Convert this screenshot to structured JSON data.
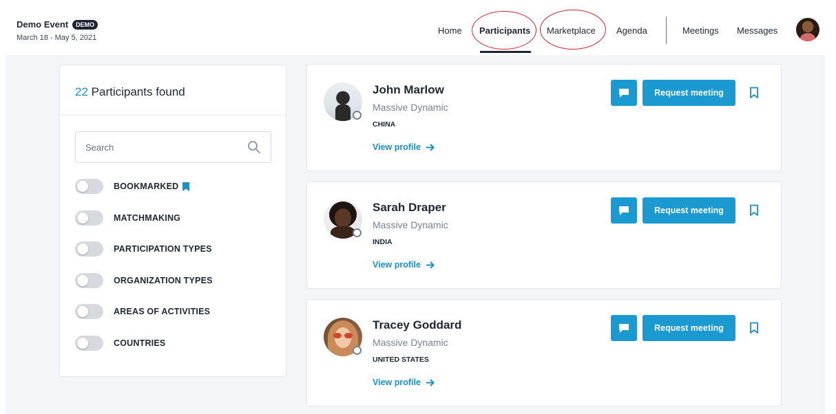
{
  "header": {
    "event_name": "Demo Event",
    "badge": "DEMO",
    "dates": "March 18 - May 5, 2021",
    "nav": {
      "home": "Home",
      "participants": "Participants",
      "marketplace": "Marketplace",
      "agenda": "Agenda",
      "meetings": "Meetings",
      "messages": "Messages"
    },
    "active_nav": "Participants"
  },
  "filters": {
    "count": "22",
    "found_label": "Participants found",
    "search_placeholder": "Search",
    "search_value": "",
    "toggles": [
      {
        "label": "BOOKMARKED",
        "on": false
      },
      {
        "label": "MATCHMAKING",
        "on": false
      },
      {
        "label": "PARTICIPATION TYPES",
        "on": false
      },
      {
        "label": "ORGANIZATION TYPES",
        "on": false
      },
      {
        "label": "AREAS OF ACTIVITIES",
        "on": false
      },
      {
        "label": "COUNTRIES",
        "on": false
      }
    ]
  },
  "participants": [
    {
      "name": "John Marlow",
      "org": "Massive Dynamic",
      "country": "CHINA",
      "link": "View profile",
      "button": "Request meeting"
    },
    {
      "name": "Sarah Draper",
      "org": "Massive Dynamic",
      "country": "INDIA",
      "link": "View profile",
      "button": "Request meeting"
    },
    {
      "name": "Tracey Goddard",
      "org": "Massive Dynamic",
      "country": "UNITED STATES",
      "link": "View profile",
      "button": "Request meeting"
    }
  ],
  "colors": {
    "accent": "#1a9ad0",
    "text": "#1f2633",
    "annotation": "#d41f2a"
  },
  "icons": {
    "search": "search-icon",
    "chat": "chat-icon",
    "bookmark": "bookmark-icon",
    "arrow": "arrow-right-icon"
  }
}
